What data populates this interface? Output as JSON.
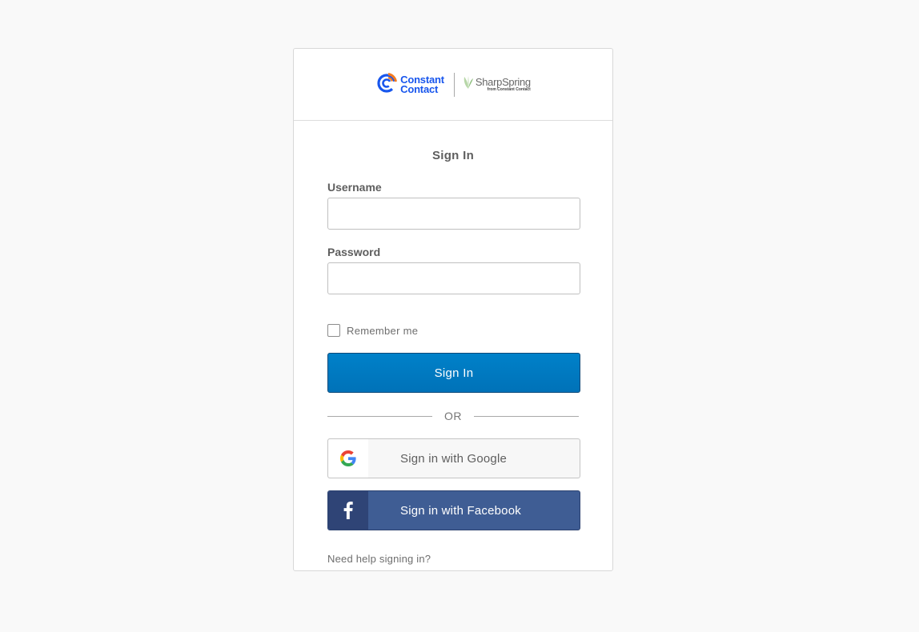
{
  "header": {
    "logo_primary_line1": "Constant",
    "logo_primary_line2": "Contact",
    "logo_secondary_name": "SharpSpring",
    "logo_secondary_sub": "from Constant Contact"
  },
  "form": {
    "title": "Sign In",
    "username_label": "Username",
    "username_value": "",
    "password_label": "Password",
    "password_value": "",
    "remember_label": "Remember me",
    "remember_checked": false,
    "submit_label": "Sign In"
  },
  "divider": {
    "text": "OR"
  },
  "social": {
    "google_label": "Sign in with Google",
    "facebook_label": "Sign in with Facebook"
  },
  "footer": {
    "help_link": "Need help signing in?"
  },
  "colors": {
    "primary_button": "#007dc1",
    "facebook": "#3f5d94",
    "brand_blue": "#1856ed",
    "brand_orange": "#f47b20"
  },
  "icons": {
    "primary_logo": "constant-contact-logo-icon",
    "secondary_logo": "sharpspring-leaf-icon",
    "google": "google-g-icon",
    "facebook": "facebook-f-icon"
  }
}
